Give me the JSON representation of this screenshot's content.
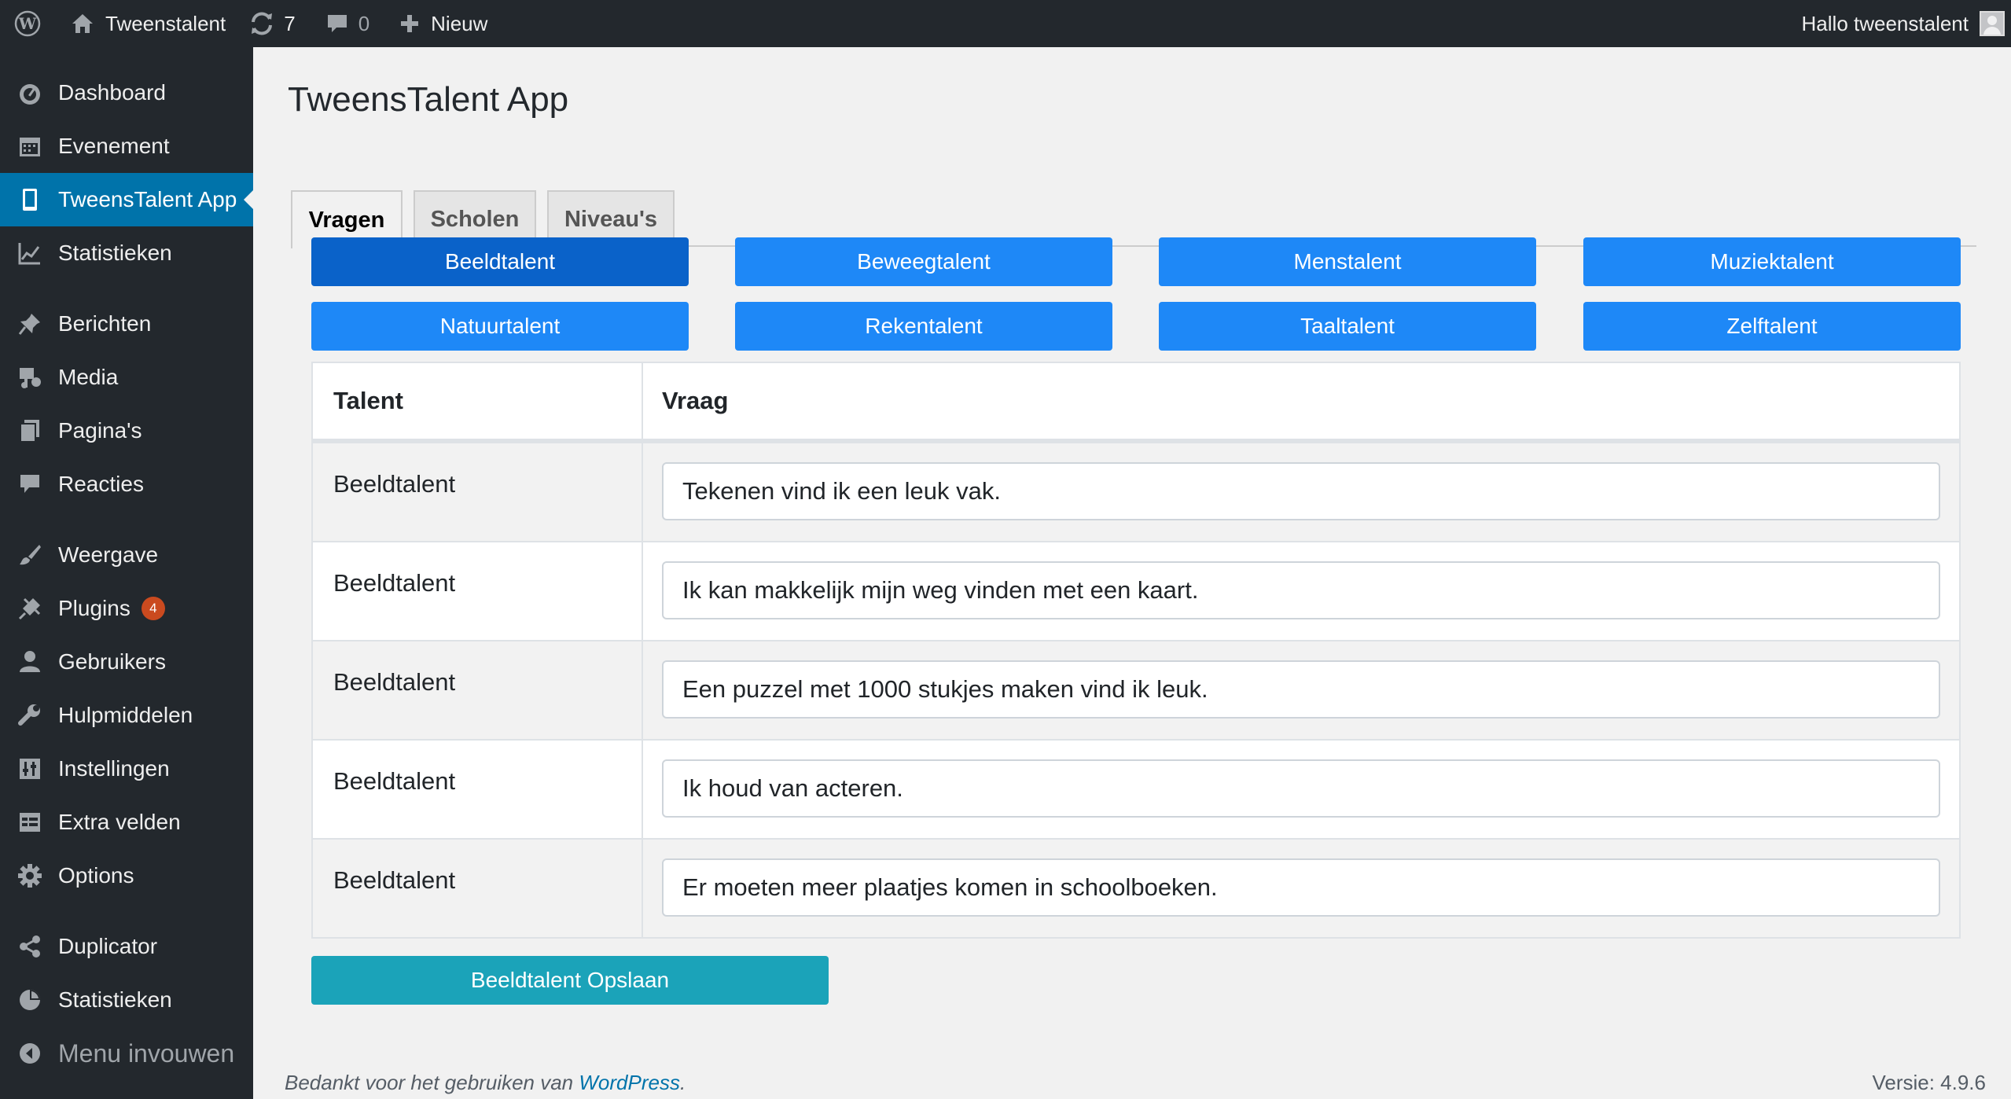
{
  "adminbar": {
    "site_name": "Tweenstalent",
    "updates_count": "7",
    "comments_count": "0",
    "new_label": "Nieuw",
    "greeting": "Hallo tweenstalent"
  },
  "sidebar": {
    "items": [
      {
        "label": "Dashboard",
        "icon": "dashboard-icon"
      },
      {
        "label": "Evenement",
        "icon": "calendar-icon"
      },
      {
        "label": "TweensTalent App",
        "icon": "tablet-icon"
      },
      {
        "label": "Statistieken",
        "icon": "chart-line-icon"
      },
      {
        "label": "Berichten",
        "icon": "pin-icon"
      },
      {
        "label": "Media",
        "icon": "media-icon"
      },
      {
        "label": "Pagina's",
        "icon": "pages-icon"
      },
      {
        "label": "Reacties",
        "icon": "comment-icon"
      },
      {
        "label": "Weergave",
        "icon": "brush-icon"
      },
      {
        "label": "Plugins",
        "icon": "plugin-icon",
        "badge": "4"
      },
      {
        "label": "Gebruikers",
        "icon": "users-icon"
      },
      {
        "label": "Hulpmiddelen",
        "icon": "wrench-icon"
      },
      {
        "label": "Instellingen",
        "icon": "settings-icon"
      },
      {
        "label": "Extra velden",
        "icon": "grid-icon"
      },
      {
        "label": "Options",
        "icon": "gear-icon"
      },
      {
        "label": "Duplicator",
        "icon": "share-icon"
      },
      {
        "label": "Statistieken",
        "icon": "pie-chart-icon"
      },
      {
        "label": "Menu invouwen",
        "icon": "collapse-icon"
      }
    ],
    "current_index": 2
  },
  "page": {
    "title": "TweensTalent App",
    "tabs": [
      {
        "label": "Vragen",
        "active": true
      },
      {
        "label": "Scholen",
        "active": false
      },
      {
        "label": "Niveau's",
        "active": false
      }
    ],
    "talent_buttons": [
      "Beeldtalent",
      "Beweegtalent",
      "Menstalent",
      "Muziektalent",
      "Natuurtalent",
      "Rekentalent",
      "Taaltalent",
      "Zelftalent"
    ],
    "active_talent": "Beeldtalent",
    "table": {
      "headers": [
        "Talent",
        "Vraag"
      ],
      "rows": [
        {
          "talent": "Beeldtalent",
          "vraag": "Tekenen vind ik een leuk vak."
        },
        {
          "talent": "Beeldtalent",
          "vraag": "Ik kan makkelijk mijn weg vinden met een kaart."
        },
        {
          "talent": "Beeldtalent",
          "vraag": "Een puzzel met 1000 stukjes maken vind ik leuk."
        },
        {
          "talent": "Beeldtalent",
          "vraag": "Ik houd van acteren."
        },
        {
          "talent": "Beeldtalent",
          "vraag": "Er moeten meer plaatjes komen in schoolboeken."
        }
      ]
    },
    "save_label": "Beeldtalent Opslaan"
  },
  "footer": {
    "thanks_prefix": "Bedankt voor het gebruiken van ",
    "thanks_link": "WordPress",
    "thanks_suffix": ".",
    "version": "Versie: 4.9.6"
  },
  "colors": {
    "adminbar_bg": "#23282d",
    "menu_current": "#0073aa",
    "talent_button": "#1e88f7",
    "talent_button_active": "#0a62c9",
    "save_button": "#1ba3b9",
    "badge": "#ca4a1f"
  }
}
